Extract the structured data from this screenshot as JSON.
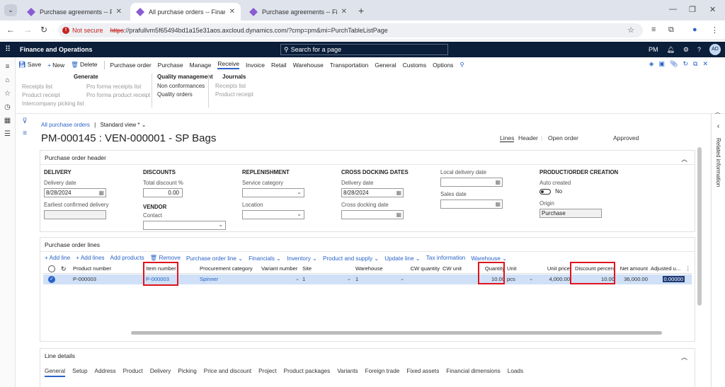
{
  "browser": {
    "tabs": [
      {
        "title": "Purchase agreements -- Financ",
        "active": false
      },
      {
        "title": "All purchase orders -- Finance a",
        "active": true
      },
      {
        "title": "Purchase agreements -- Financ",
        "active": false
      }
    ],
    "security_label": "Not secure",
    "url_protocol": "https",
    "url_rest": "://prafullvm5f65494bd1a15e31aos.axcloud.dynamics.com/?cmp=pm&mi=PurchTableListPage"
  },
  "appbar": {
    "app_name": "Finance and Operations",
    "search_placeholder": "Search for a page",
    "company": "PM",
    "avatar": "AD"
  },
  "actionpane": {
    "actions": [
      {
        "label": "Save",
        "icon": "save-icon"
      },
      {
        "label": "New",
        "icon": "plus-icon"
      },
      {
        "label": "Delete",
        "icon": "trash-icon"
      },
      {
        "label": "Purchase order"
      },
      {
        "label": "Purchase"
      },
      {
        "label": "Manage"
      },
      {
        "label": "Receive",
        "selected": true
      },
      {
        "label": "Invoice"
      },
      {
        "label": "Retail"
      },
      {
        "label": "Warehouse"
      },
      {
        "label": "Transportation"
      },
      {
        "label": "General"
      },
      {
        "label": "Customs"
      },
      {
        "label": "Options"
      }
    ],
    "groups": {
      "generate": {
        "header": "Generate",
        "col1": [
          "Receipts list",
          "Product receipt",
          "Intercompany picking list"
        ],
        "col2": [
          "Pro forma receipts list",
          "Pro forma product receipt"
        ]
      },
      "quality": {
        "header": "Quality management",
        "items": [
          "Non conformances",
          "Quality orders"
        ]
      },
      "journals": {
        "header": "Journals",
        "items": [
          "Receipts list",
          "Product receipt"
        ]
      }
    }
  },
  "form": {
    "breadcrumb_link": "All purchase orders",
    "breadcrumb_sep": "|",
    "view_name": "Standard view *",
    "title": "PM-000145 : VEN-000001 - SP Bags",
    "view_tabs": {
      "lines": "Lines",
      "header": "Header"
    },
    "status_open": "Open order",
    "status_approved": "Approved",
    "related_info": "Related information"
  },
  "po_header": {
    "section_title": "Purchase order header",
    "delivery": {
      "header": "DELIVERY",
      "delivery_date_label": "Delivery date",
      "delivery_date": "8/28/2024",
      "earliest_label": "Earliest confirmed delivery",
      "earliest_value": ""
    },
    "discounts": {
      "header": "DISCOUNTS",
      "total_discount_label": "Total discount %",
      "total_discount": "0.00"
    },
    "vendor": {
      "header": "VENDOR",
      "contact_label": "Contact",
      "contact_value": ""
    },
    "replenishment": {
      "header": "REPLENISHMENT",
      "service_category_label": "Service category",
      "location_label": "Location"
    },
    "cross_docking": {
      "header": "CROSS DOCKING DATES",
      "delivery_date_label": "Delivery date",
      "delivery_date": "8/28/2024",
      "cross_docking_date_label": "Cross docking date"
    },
    "local": {
      "local_delivery_label": "Local delivery date",
      "sales_date_label": "Sales date"
    },
    "product_order_creation": {
      "header": "PRODUCT/ORDER CREATION",
      "auto_created_label": "Auto created",
      "auto_created_value": "No",
      "origin_label": "Origin",
      "origin_value": "Purchase"
    }
  },
  "po_lines": {
    "section_title": "Purchase order lines",
    "toolbar": [
      "Add line",
      "Add lines",
      "Add products",
      "Remove",
      "Purchase order line",
      "Financials",
      "Inventory",
      "Product and supply",
      "Update line",
      "Tax information",
      "Warehouse"
    ],
    "columns": [
      "Product number",
      "Item number",
      "Procurement category",
      "Variant number",
      "Site",
      "Warehouse",
      "CW quantity",
      "CW unit",
      "Quantity",
      "Unit",
      "Unit price",
      "Discount percent",
      "Net amount",
      "Adjusted u..."
    ],
    "row": {
      "product_number": "P-000003",
      "item_number": "P-000003",
      "procurement_category": "Spinner",
      "variant_number": "",
      "site": "1",
      "warehouse": "1",
      "cw_quantity": "",
      "cw_unit": "",
      "quantity": "10.00",
      "unit": "pcs",
      "unit_price": "4,000.00",
      "discount_percent": "10.00",
      "net_amount": "36,000.00",
      "adjusted_unit": "0.00000"
    }
  },
  "line_details": {
    "section_title": "Line details",
    "tabs": [
      "General",
      "Setup",
      "Address",
      "Product",
      "Delivery",
      "Picking",
      "Price and discount",
      "Project",
      "Product packages",
      "Variants",
      "Foreign trade",
      "Fixed assets",
      "Financial dimensions",
      "Loads"
    ]
  },
  "colors": {
    "accent": "#2a63c8",
    "appbar": "#0b1e3a",
    "highlight": "#e0141e",
    "selected_row": "#cfe0f7"
  }
}
